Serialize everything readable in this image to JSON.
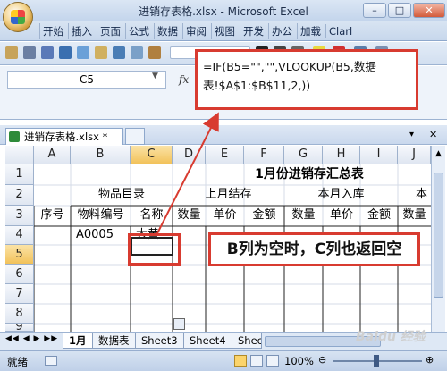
{
  "window": {
    "title": "进销存表格.xlsx - Microsoft Excel",
    "minimize": "–",
    "restore": "□",
    "close": "✕"
  },
  "ribbon_tabs": [
    "开始",
    "插入",
    "页面",
    "公式",
    "数据",
    "审阅",
    "视图",
    "开发",
    "办公",
    "加载",
    "Clarl"
  ],
  "formula_bar": {
    "name_box": "C5",
    "fx": "fx",
    "formula": "=IF(B5=\"\",\"\",VLOOKUP(B5,数据表!$A$1:$B$11,2,))"
  },
  "workbook_tab": {
    "name": "进销存表格.xlsx *",
    "close": "✕"
  },
  "columns": [
    "A",
    "B",
    "C",
    "D",
    "E",
    "F",
    "G",
    "H",
    "I",
    "J"
  ],
  "rows": [
    "1",
    "2",
    "3",
    "4",
    "5",
    "6",
    "7",
    "8",
    "9",
    "10"
  ],
  "sheet": {
    "title": "1月份进销存汇总表",
    "group1": "物品目录",
    "group2": "上月结存",
    "group3": "本月入库",
    "group4": "本",
    "headers": [
      "序号",
      "物料编号",
      "名称",
      "数量",
      "单价",
      "金额",
      "数量",
      "单价",
      "金额",
      "数量"
    ],
    "row4": {
      "b": "A0005",
      "c": "大黄"
    }
  },
  "callout": "B列为空时，C列也返回空",
  "sheet_tabs": [
    "1月",
    "数据表",
    "Sheet3",
    "Sheet4",
    "Sheet"
  ],
  "status": {
    "ready": "就绪",
    "zoom": "100%"
  },
  "watermark": "Baidu 经验",
  "colors": {
    "accent_red": "#d83b30",
    "excel_green": "#2e8b3a"
  }
}
